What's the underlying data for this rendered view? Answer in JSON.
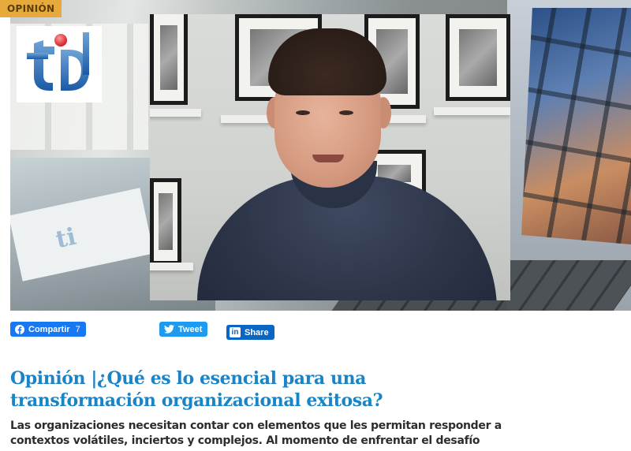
{
  "article": {
    "category": "OPINIÓN",
    "title": "Opinión |¿Qué es lo esencial para una transformación organizacional exitosa?",
    "lead": "Las organizaciones necesitan contar con elementos que les permitan responder a contextos volátiles, inciertos y complejos. Al momento de enfrentar el desafío"
  },
  "hero": {
    "logo_icon": "ti-logo-icon",
    "paper_mark": "ti"
  },
  "share": {
    "facebook_label": "Compartir",
    "facebook_count": "7",
    "twitter_label": "Tweet",
    "linkedin_label": "Share",
    "linkedin_icon_text": "in"
  },
  "colors": {
    "title": "#1a84c7",
    "category_tag": "#e8a93b",
    "facebook": "#1877f2",
    "twitter": "#1d9bf0",
    "linkedin": "#0a66c2"
  }
}
